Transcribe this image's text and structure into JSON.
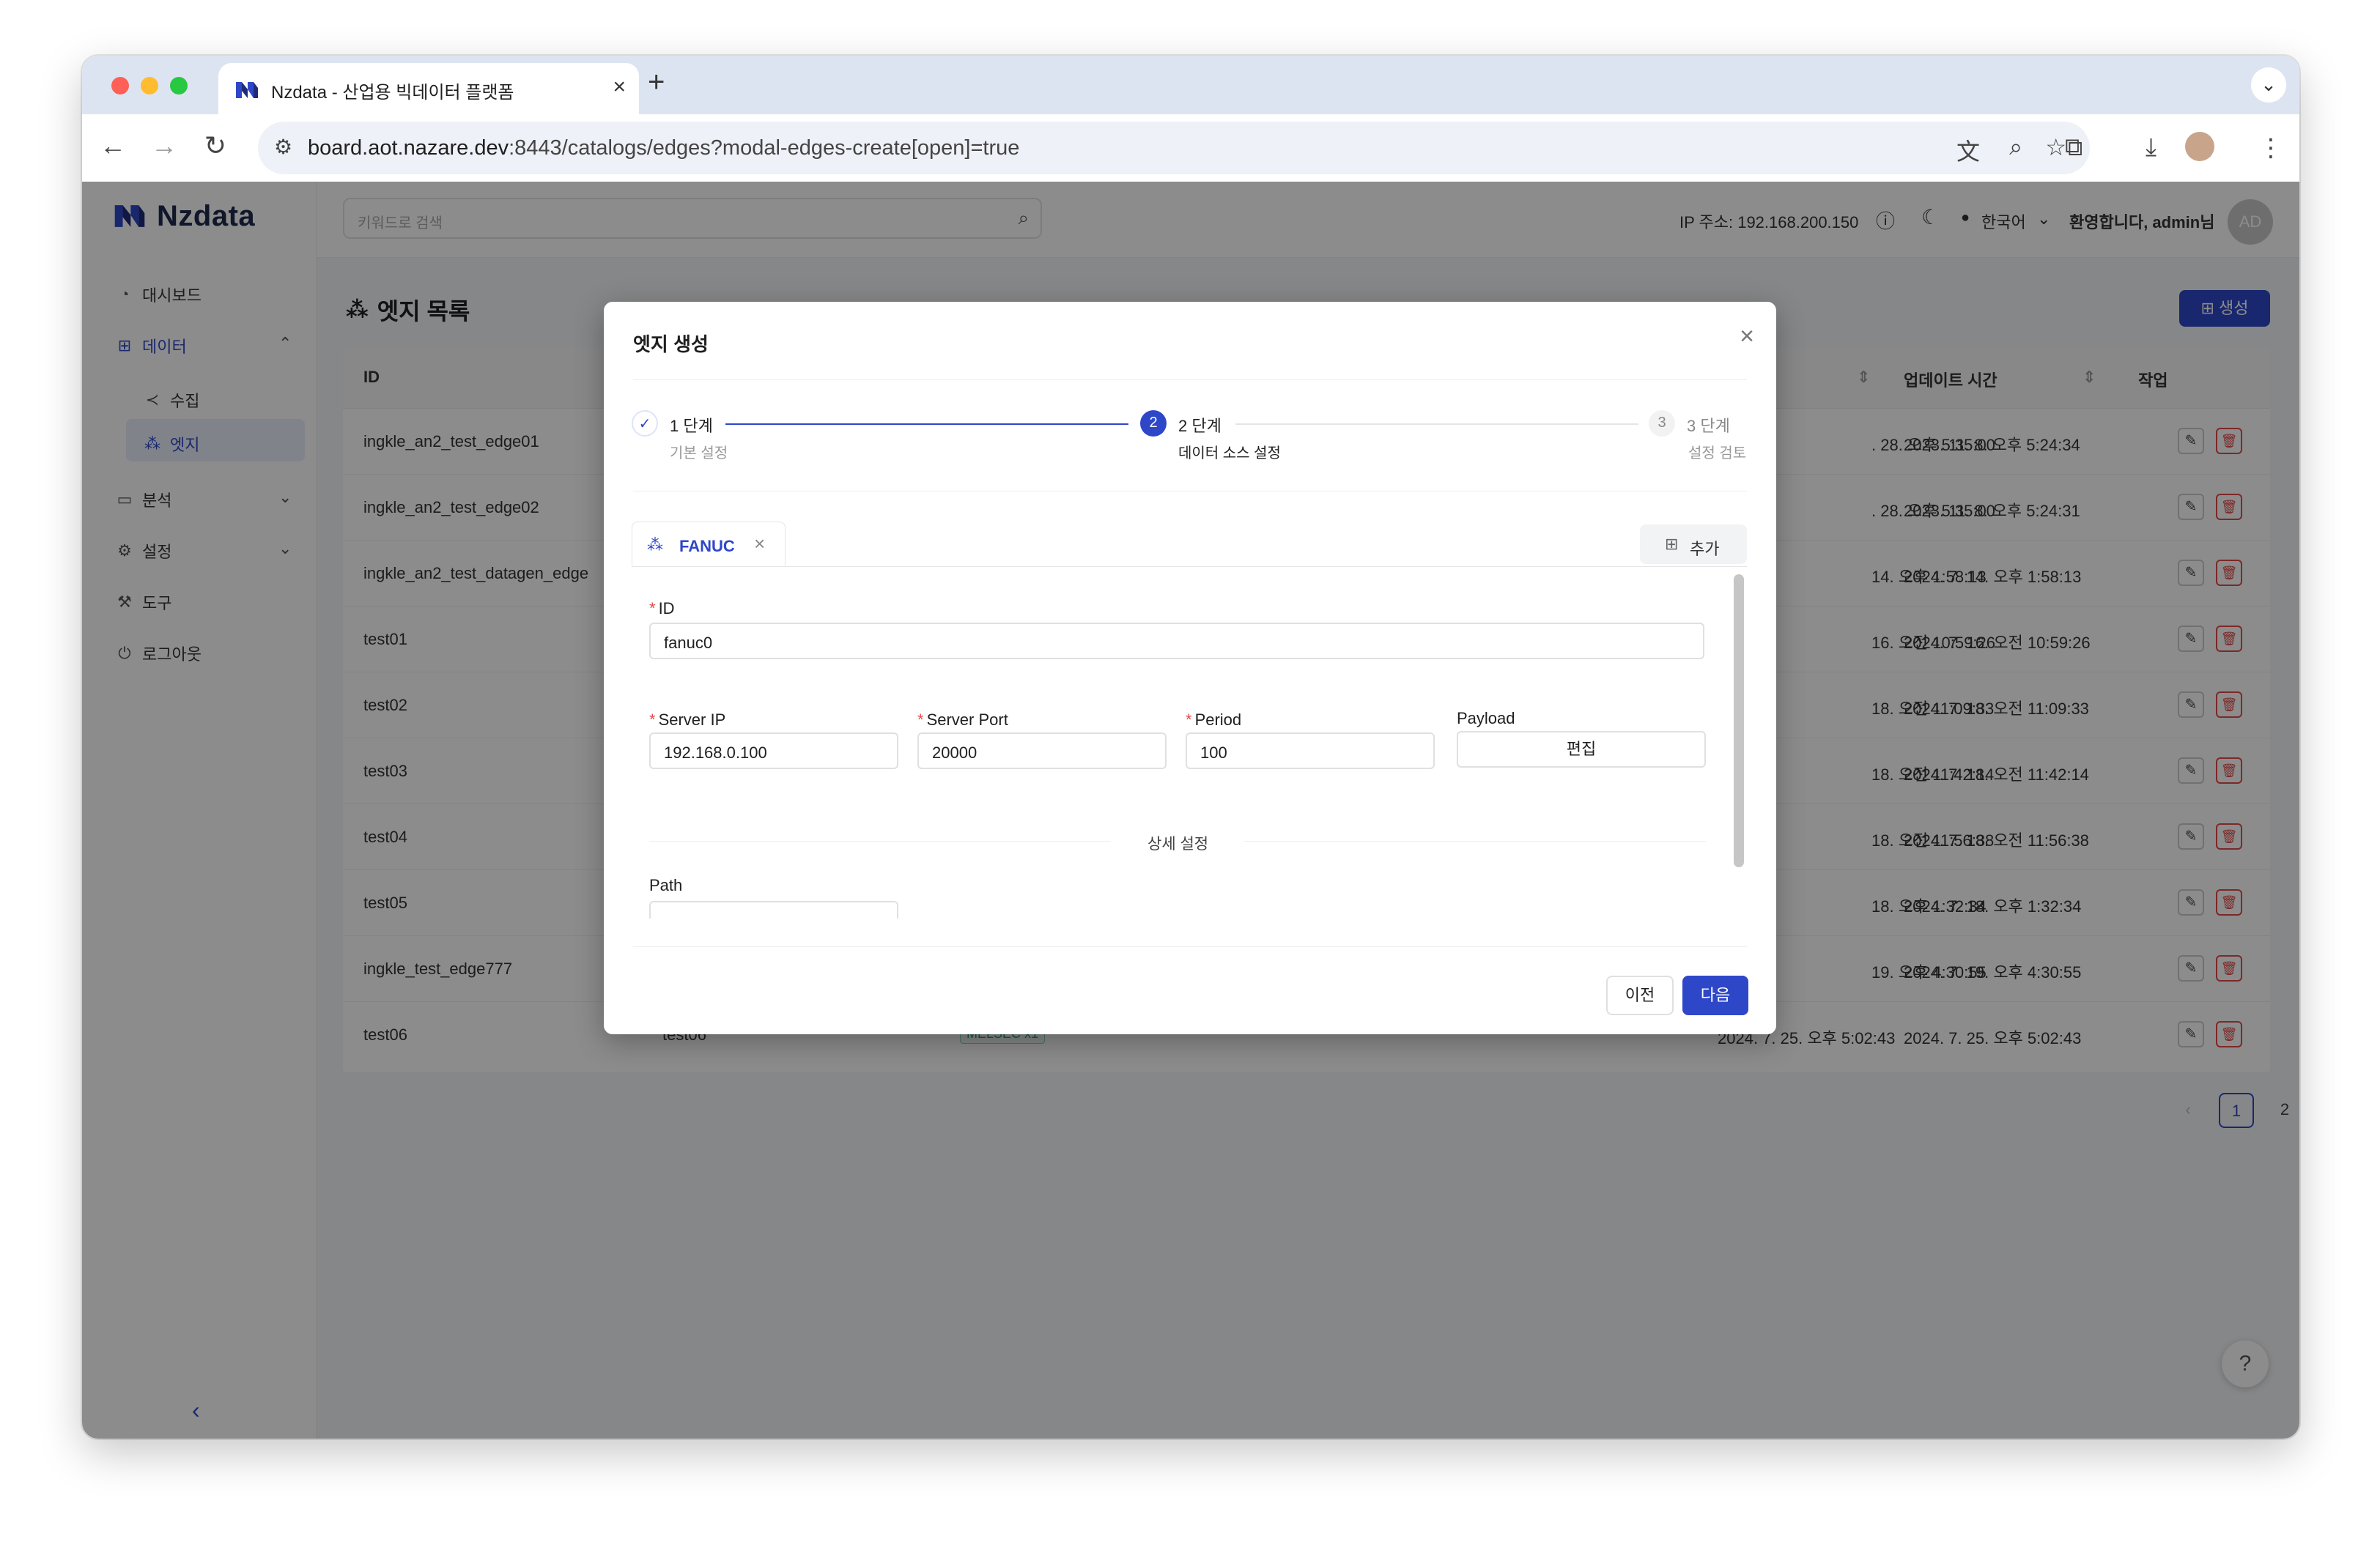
{
  "browser": {
    "tab_title": "Nzdata - 산업용 빅데이터 플랫폼",
    "url_host": "board.aot.nazare.dev",
    "url_path": ":8443/catalogs/edges?modal-edges-create[open]=true"
  },
  "app": {
    "logo_text": "Nzdata",
    "search_placeholder": "키워드로 검색",
    "ip_label": "IP 주소: 192.168.200.150",
    "language": "한국어",
    "welcome": "환영합니다, admin님",
    "avatar": "AD"
  },
  "sidebar": {
    "items": [
      {
        "label": "대시보드",
        "icon": "dashboard-icon"
      },
      {
        "label": "데이터",
        "icon": "data-icon"
      },
      {
        "label": "수집",
        "icon": "share-icon"
      },
      {
        "label": "엣지",
        "icon": "edge-icon"
      },
      {
        "label": "분석",
        "icon": "monitor-icon"
      },
      {
        "label": "설정",
        "icon": "gear-icon"
      },
      {
        "label": "도구",
        "icon": "wrench-icon"
      },
      {
        "label": "로그아웃",
        "icon": "logout-icon"
      }
    ]
  },
  "page": {
    "title": "엣지 목록",
    "create_label": "생성",
    "columns": {
      "id": "ID",
      "updated": "업데이트 시간",
      "action": "작업"
    },
    "rows": [
      {
        "id": "ingkle_an2_test_edge01",
        "created": ". 28. 오후 5:35:00",
        "updated": "2023. 11. 8. 오후 5:24:34"
      },
      {
        "id": "ingkle_an2_test_edge02",
        "created": ". 28. 오후 5:35:00",
        "updated": "2023. 11. 8. 오후 5:24:31"
      },
      {
        "id": "ingkle_an2_test_datagen_edge",
        "created": "14. 오후 1:58:13",
        "updated": "2024. 7. 14. 오후 1:58:13"
      },
      {
        "id": "test01",
        "created": "16. 오전 10:59:26",
        "updated": "2024. 7. 16. 오전 10:59:26"
      },
      {
        "id": "test02",
        "created": "18. 오전 11:09:33",
        "updated": "2024. 7. 18. 오전 11:09:33"
      },
      {
        "id": "test03",
        "created": "18. 오전 11:42:14",
        "updated": "2024. 7. 18. 오전 11:42:14"
      },
      {
        "id": "test04",
        "created": "18. 오전 11:56:38",
        "updated": "2024. 7. 18. 오전 11:56:38"
      },
      {
        "id": "test05",
        "created": "18. 오후 1:32:34",
        "updated": "2024. 7. 18. 오후 1:32:34"
      },
      {
        "id": "ingkle_test_edge777",
        "created": "19. 오후 4:30:55",
        "updated": "2024. 7. 19. 오후 4:30:55"
      },
      {
        "id": "test06",
        "name": "test06",
        "tag": "MELSEC x1",
        "created": "2024. 7. 25. 오후 5:02:43",
        "updated": "2024. 7. 25. 오후 5:02:43"
      }
    ],
    "pages": [
      "1",
      "2"
    ],
    "current_page": 1
  },
  "modal": {
    "title": "엣지 생성",
    "steps": [
      {
        "num": "✓",
        "title": "1 단계",
        "subtitle": "기본 설정",
        "state": "done"
      },
      {
        "num": "2",
        "title": "2 단계",
        "subtitle": "데이터 소스 설정",
        "state": "active"
      },
      {
        "num": "3",
        "title": "3 단계",
        "subtitle": "설정 검토",
        "state": "pending"
      }
    ],
    "source_tab": "FANUC",
    "add_label": "추가",
    "form": {
      "id_label": "ID",
      "id_value": "fanuc0",
      "server_ip_label": "Server IP",
      "server_ip_value": "192.168.0.100",
      "server_port_label": "Server Port",
      "server_port_value": "20000",
      "period_label": "Period",
      "period_value": "100",
      "payload_label": "Payload",
      "payload_button": "편집",
      "detail_divider": "상세 설정",
      "path_label": "Path"
    },
    "prev_label": "이전",
    "next_label": "다음"
  },
  "colors": {
    "accent": "#2e47c9",
    "danger": "#e34a4a"
  }
}
